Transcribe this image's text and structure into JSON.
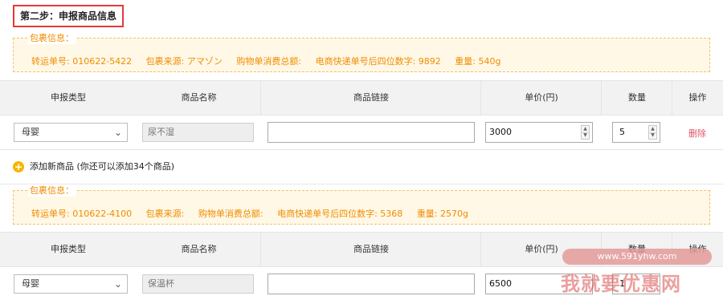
{
  "step": {
    "title": "第二步：申报商品信息"
  },
  "packages": [
    {
      "info_title": "包裹信息：",
      "info": [
        "转运单号: 010622-5422",
        "包裹来源: アマゾン",
        "购物单消费总额:",
        "电商快递单号后四位数字: 9892",
        "重量: 540g"
      ],
      "table": {
        "headers": {
          "type": "申报类型",
          "name": "商品名称",
          "link": "商品链接",
          "price": "单价(円)",
          "qty": "数量",
          "op": "操作"
        },
        "row": {
          "type": "母婴",
          "name": "尿不湿",
          "link": "",
          "price": "3000",
          "qty": "5",
          "delete": "删除"
        }
      }
    },
    {
      "info_title": "包裹信息：",
      "info": [
        "转运单号: 010622-4100",
        "包裹来源:",
        "购物单消费总额:",
        "电商快递单号后四位数字: 5368",
        "重量: 2570g"
      ],
      "table": {
        "headers": {
          "type": "申报类型",
          "name": "商品名称",
          "link": "商品链接",
          "price": "单价(円)",
          "qty": "数量",
          "op": "操作"
        },
        "row": {
          "type": "母婴",
          "name": "保温杯",
          "link": "",
          "price": "6500",
          "qty": "1"
        }
      }
    }
  ],
  "add_product": {
    "icon": "plus-icon",
    "label": "添加新商品 (你还可以添加34个商品)"
  },
  "watermark": {
    "url": "www.591yhw.com",
    "text": "我就要优惠网"
  },
  "colors": {
    "accent_orange": "#f08c00",
    "info_bg": "#fff8e6",
    "delete_red": "#e05263",
    "title_border": "#e53935",
    "add_icon": "#f7b500"
  }
}
